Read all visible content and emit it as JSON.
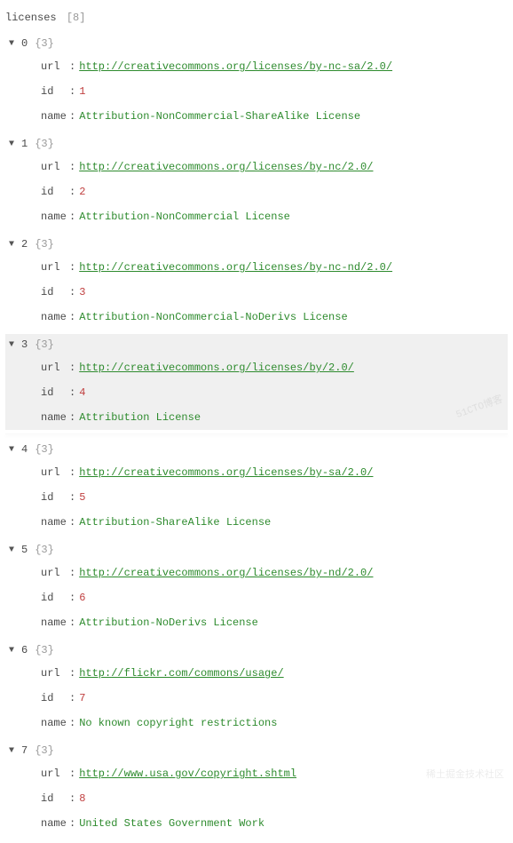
{
  "root_key": "licenses",
  "root_count_label": "[8]",
  "toggle_glyph": "▼",
  "brace_label": "{3}",
  "colon_label": ":",
  "prop_labels": {
    "url": "url",
    "id": "id",
    "name": "name"
  },
  "items": [
    {
      "index": "0",
      "url": "http://creativecommons.org/licenses/by-nc-sa/2.0/",
      "id": "1",
      "name": "Attribution-NonCommercial-ShareAlike License"
    },
    {
      "index": "1",
      "url": "http://creativecommons.org/licenses/by-nc/2.0/",
      "id": "2",
      "name": "Attribution-NonCommercial License"
    },
    {
      "index": "2",
      "url": "http://creativecommons.org/licenses/by-nc-nd/2.0/",
      "id": "3",
      "name": "Attribution-NonCommercial-NoDerivs License"
    },
    {
      "index": "3",
      "url": "http://creativecommons.org/licenses/by/2.0/",
      "id": "4",
      "name": "Attribution License"
    },
    {
      "index": "4",
      "url": "http://creativecommons.org/licenses/by-sa/2.0/",
      "id": "5",
      "name": "Attribution-ShareAlike License"
    },
    {
      "index": "5",
      "url": "http://creativecommons.org/licenses/by-nd/2.0/",
      "id": "6",
      "name": "Attribution-NoDerivs License"
    },
    {
      "index": "6",
      "url": "http://flickr.com/commons/usage/",
      "id": "7",
      "name": "No known copyright restrictions"
    },
    {
      "index": "7",
      "url": "http://www.usa.gov/copyright.shtml",
      "id": "8",
      "name": "United States Government Work"
    }
  ],
  "highlight_index": "3",
  "shadow_after_index": "3",
  "watermarks": {
    "wm1": "51CTO博客",
    "wm2": "稀土掘金技术社区"
  }
}
